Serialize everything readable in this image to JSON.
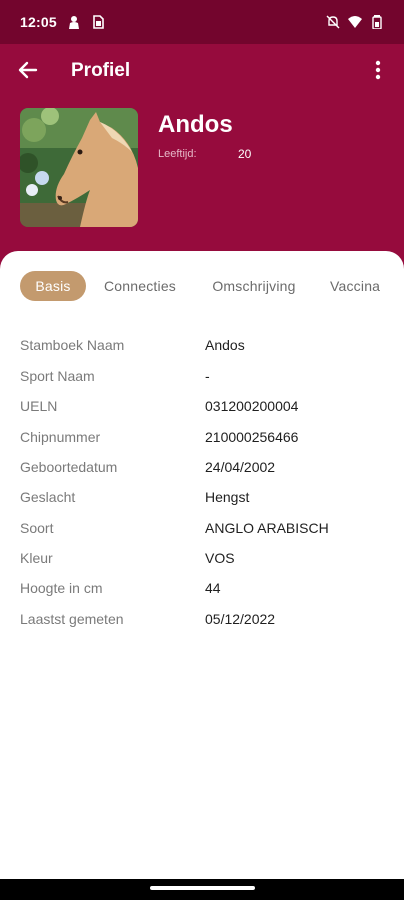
{
  "status_bar": {
    "time": "12:05",
    "icons": [
      "person-icon",
      "sim-icon",
      "notifications-off-icon",
      "wifi-icon",
      "battery-icon"
    ]
  },
  "appbar": {
    "title": "Profiel",
    "back_icon": "arrow-left-icon",
    "menu_icon": "more-vertical-icon"
  },
  "profile": {
    "name": "Andos",
    "age_label": "Leeftijd:",
    "age_value": "20",
    "photo": "horse-photo"
  },
  "tabs": [
    {
      "label": "Basis",
      "active": true
    },
    {
      "label": "Connecties",
      "active": false
    },
    {
      "label": "Omschrijving",
      "active": false
    },
    {
      "label": "Vaccina",
      "active": false
    }
  ],
  "info": [
    {
      "label": "Stamboek Naam",
      "value": "Andos"
    },
    {
      "label": "Sport Naam",
      "value": "-"
    },
    {
      "label": "UELN",
      "value": "031200200004"
    },
    {
      "label": "Chipnummer",
      "value": "210000256466"
    },
    {
      "label": "Geboortedatum",
      "value": "24/04/2002"
    },
    {
      "label": "Geslacht",
      "value": "Hengst"
    },
    {
      "label": "Soort",
      "value": "ANGLO ARABISCH"
    },
    {
      "label": "Kleur",
      "value": "VOS"
    },
    {
      "label": "Hoogte in cm",
      "value": "44"
    },
    {
      "label": "Laastst gemeten",
      "value": "05/12/2022"
    }
  ],
  "colors": {
    "status_bar": "#73052d",
    "header": "#960b3d",
    "accent": "#c39a6e",
    "label": "#7a7a7a",
    "value": "#1f1f1f"
  }
}
